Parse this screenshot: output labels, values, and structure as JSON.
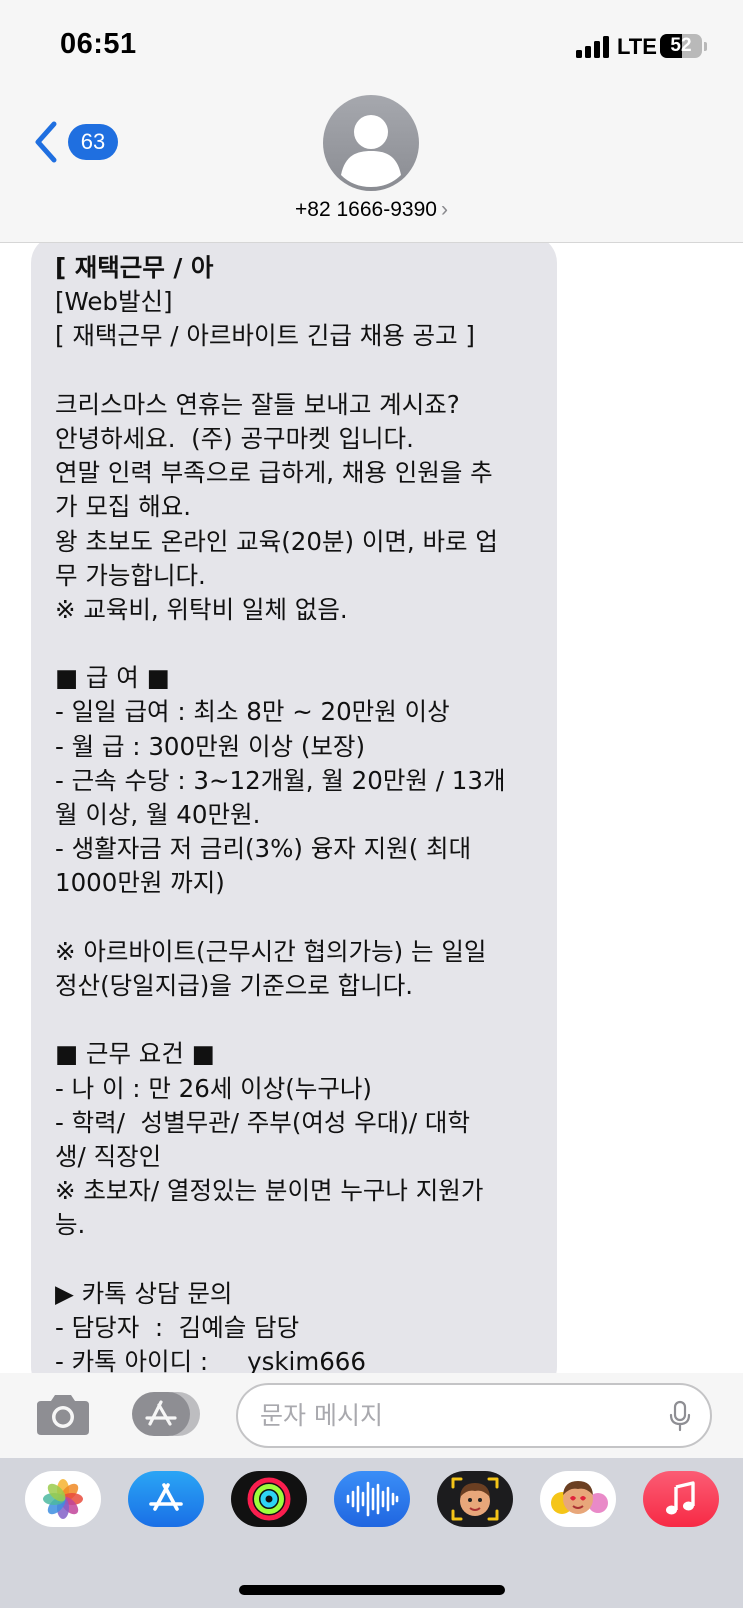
{
  "status_bar": {
    "time": "06:51",
    "network": "LTE",
    "battery": "52",
    "battery_level": 0.52
  },
  "header": {
    "back_count": "63",
    "contact": "+82 1666-9390",
    "contact_chevron": "›"
  },
  "message": {
    "lines": [
      "[ 재택근무 / 아",
      "[Web발신]",
      "[ 재택근무 / 아르바이트 긴급 채용 공고 ]",
      "",
      "크리스마스 연휴는 잘들 보내고 계시죠?",
      "안녕하세요.  (주) 공구마켓 입니다.",
      "연말 인력 부족으로 급하게, 채용 인원을 추",
      "가 모집 해요.",
      "왕 초보도 온라인 교육(20분) 이면, 바로 업",
      "무 가능합니다.",
      "※ 교육비, 위탁비 일체 없음.",
      "",
      "■ 급 여 ■",
      "- 일일 급여 : 최소 8만 ~ 20만원 이상",
      "- 월 급 : 300만원 이상 (보장)",
      "- 근속 수당 : 3~12개월, 월 20만원 / 13개",
      "월 이상, 월 40만원.",
      "- 생활자금 저 금리(3%) 융자 지원( 최대",
      "1000만원 까지)",
      "",
      "※ 아르바이트(근무시간 협의가능) 는 일일",
      "정산(당일지급)을 기준으로 합니다.",
      "",
      "■ 근무 요건 ■",
      "- 나 이 : 만 26세 이상(누구나)",
      "- 학력/  성별무관/ 주부(여성 우대)/ 대학",
      "생/ 직장인",
      "※ 초보자/ 열정있는 분이면 누구나 지원가",
      "능.",
      "",
      "▶ 카톡 상담 문의",
      "- 담당자  :  김예슬 담당",
      "- 카톡 아이디 :     yskim666"
    ]
  },
  "input": {
    "placeholder": "문자 메시지"
  },
  "icons": {
    "back": "chevron-left-icon",
    "avatar": "person-avatar-icon",
    "camera": "camera-icon",
    "appstore": "app-store-icon",
    "mic": "microphone-icon"
  },
  "dock_apps": [
    {
      "name": "photos"
    },
    {
      "name": "app-store"
    },
    {
      "name": "fitness"
    },
    {
      "name": "voice-memos"
    },
    {
      "name": "memoji-sticker"
    },
    {
      "name": "animoji"
    },
    {
      "name": "music"
    }
  ],
  "colors": {
    "accent": "#1f6fe0",
    "bubble": "#e5e5ea",
    "bar": "#f6f6f6",
    "dock": "#d3d5dc"
  }
}
